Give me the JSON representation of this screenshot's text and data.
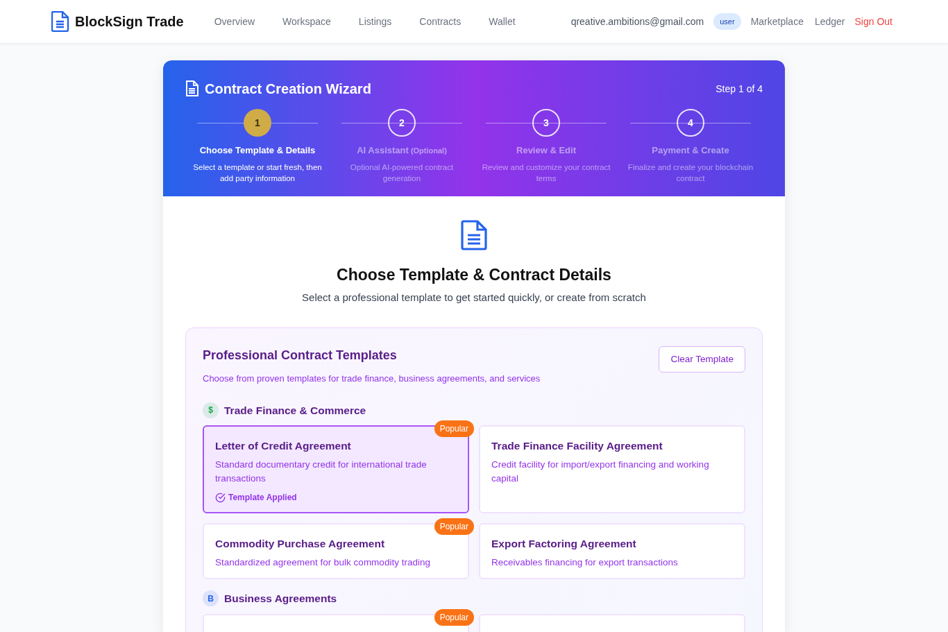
{
  "brand": {
    "name": "BlockSign Trade"
  },
  "nav": [
    "Overview",
    "Workspace",
    "Listings",
    "Contracts",
    "Wallet"
  ],
  "user": {
    "email": "qreative.ambitions@gmail.com",
    "role": "user"
  },
  "nav_right": [
    "Marketplace",
    "Ledger"
  ],
  "sign_out": "Sign Out",
  "wizard": {
    "title": "Contract Creation Wizard",
    "step_counter": "Step 1 of 4",
    "steps": [
      {
        "number": "1",
        "title": "Choose Template & Details",
        "description": "Select a template or start fresh, then add party information",
        "selected": true
      },
      {
        "number": "2",
        "title": "AI Assistant",
        "note": "(Optional)",
        "description": "Optional AI-powered contract generation",
        "selected": false
      },
      {
        "number": "3",
        "title": "Review & Edit",
        "description": "Review and customize your contract terms",
        "selected": false
      },
      {
        "number": "4",
        "title": "Payment & Create",
        "description": "Finalize and create your blockchain contract",
        "selected": false
      }
    ]
  },
  "section": {
    "title": "Choose Template & Contract Details",
    "subtitle": "Select a professional template to get started quickly, or create from scratch"
  },
  "templates": {
    "title": "Professional Contract Templates",
    "subtitle": "Choose from proven templates for trade finance, business agreements, and services",
    "clear_button": "Clear Template",
    "groups": [
      {
        "icon": "$",
        "color": "#16a34a",
        "name": "Trade Finance & Commerce",
        "items": [
          {
            "title": "Letter of Credit Agreement",
            "description": "Standard documentary credit for international trade transactions",
            "badge": "Popular",
            "selected": true,
            "status": "Template Applied"
          },
          {
            "title": "Trade Finance Facility Agreement",
            "description": "Credit facility for import/export financing and working capital",
            "selected": false
          },
          {
            "title": "Commodity Purchase Agreement",
            "description": "Standardized agreement for bulk commodity trading",
            "badge": "Popular",
            "selected": false
          },
          {
            "title": "Export Factoring Agreement",
            "description": "Receivables financing for export transactions",
            "selected": false
          }
        ]
      },
      {
        "icon": "B",
        "color": "#2563eb",
        "name": "Business Agreements",
        "items": [
          {
            "badge": "Popular",
            "selected": false
          },
          {
            "selected": false
          }
        ]
      }
    ]
  }
}
